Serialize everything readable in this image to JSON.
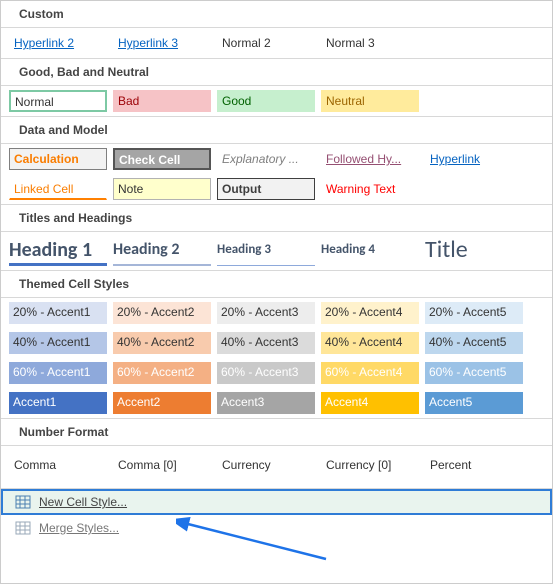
{
  "sections": {
    "custom": {
      "header": "Custom",
      "items": [
        "Hyperlink 2",
        "Hyperlink 3",
        "Normal 2",
        "Normal 3"
      ]
    },
    "gbn": {
      "header": "Good, Bad and Neutral",
      "items": [
        "Normal",
        "Bad",
        "Good",
        "Neutral"
      ]
    },
    "data_model": {
      "header": "Data and Model",
      "row1": [
        "Calculation",
        "Check Cell",
        "Explanatory ...",
        "Followed Hy...",
        "Hyperlink"
      ],
      "row2": [
        "Linked Cell",
        "Note",
        "Output",
        "Warning Text"
      ]
    },
    "titles": {
      "header": "Titles and Headings",
      "items": [
        "Heading 1",
        "Heading 2",
        "Heading 3",
        "Heading 4",
        "Title"
      ]
    },
    "themed": {
      "header": "Themed Cell Styles",
      "r1": [
        "20% - Accent1",
        "20% - Accent2",
        "20% - Accent3",
        "20% - Accent4",
        "20% - Accent5"
      ],
      "r2": [
        "40% - Accent1",
        "40% - Accent2",
        "40% - Accent3",
        "40% - Accent4",
        "40% - Accent5"
      ],
      "r3": [
        "60% - Accent1",
        "60% - Accent2",
        "60% - Accent3",
        "60% - Accent4",
        "60% - Accent5"
      ],
      "r4": [
        "Accent1",
        "Accent2",
        "Accent3",
        "Accent4",
        "Accent5"
      ]
    },
    "number": {
      "header": "Number Format",
      "items": [
        "Comma",
        "Comma [0]",
        "Currency",
        "Currency [0]",
        "Percent"
      ]
    }
  },
  "footer": {
    "new_style": "New Cell Style...",
    "merge": "Merge Styles..."
  }
}
